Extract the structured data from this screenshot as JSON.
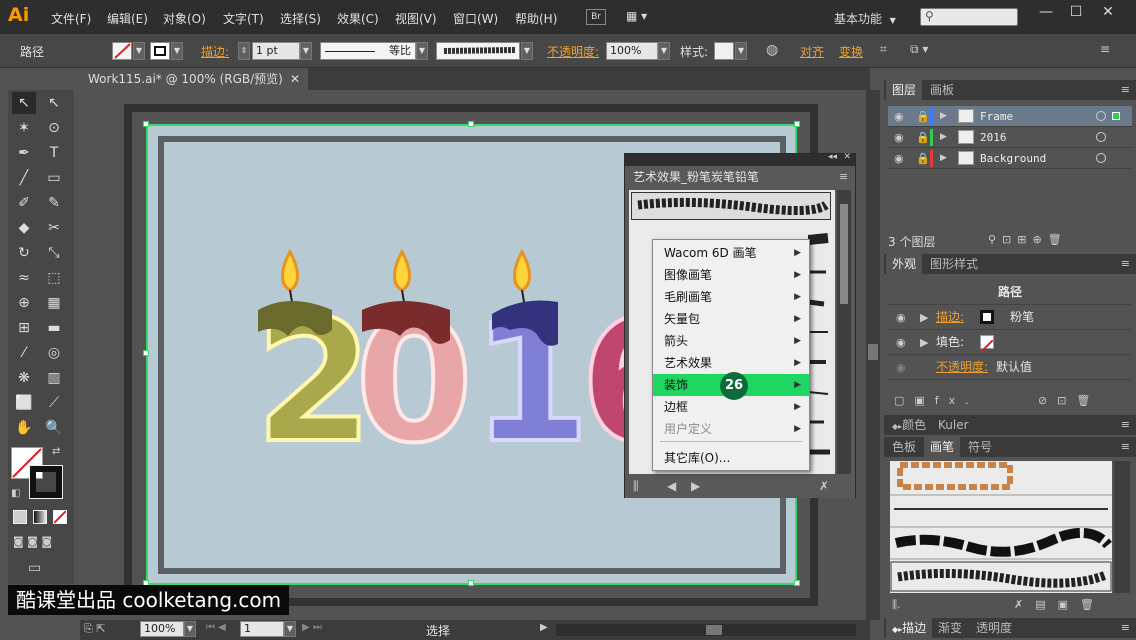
{
  "app": {
    "logo": "Ai"
  },
  "menu": [
    "文件(F)",
    "编辑(E)",
    "对象(O)",
    "文字(T)",
    "选择(S)",
    "效果(C)",
    "视图(V)",
    "窗口(W)",
    "帮助(H)"
  ],
  "toolbar_top": {
    "br": "Br",
    "workspace": "基本功能",
    "workspace_arrow": "▼",
    "min": "—",
    "max": "☐",
    "close": "✕"
  },
  "control": {
    "selection_type": "路径",
    "stroke_label": "描边:",
    "stroke_weight": "1 pt",
    "profile_label": "等比",
    "opacity_label": "不透明度:",
    "opacity_value": "100%",
    "style_label": "样式:",
    "align_label": "对齐",
    "transform_label": "变换"
  },
  "document": {
    "tab_title": "Work115.ai* @ 100% (RGB/预览)",
    "close": "✕"
  },
  "status": {
    "zoom": "100%",
    "page": "1",
    "mode": "选择"
  },
  "watermark": "酷课堂出品 coolketang.com",
  "brush_panel": {
    "title": "艺术效果_粉笔炭笔铅笔"
  },
  "flyout": {
    "items": [
      {
        "label": "Wacom 6D 画笔",
        "submenu": true,
        "state": "normal"
      },
      {
        "label": "图像画笔",
        "submenu": true,
        "state": "normal"
      },
      {
        "label": "毛刷画笔",
        "submenu": true,
        "state": "normal"
      },
      {
        "label": "矢量包",
        "submenu": true,
        "state": "normal"
      },
      {
        "label": "箭头",
        "submenu": true,
        "state": "normal"
      },
      {
        "label": "艺术效果",
        "submenu": true,
        "state": "normal"
      },
      {
        "label": "装饰",
        "submenu": true,
        "state": "active"
      },
      {
        "label": "边框",
        "submenu": true,
        "state": "normal"
      },
      {
        "label": "用户定义",
        "submenu": true,
        "state": "disabled"
      },
      {
        "label": "其它库(O)...",
        "submenu": false,
        "state": "normal"
      }
    ]
  },
  "step_badge": "26",
  "layers_panel": {
    "tabs": [
      "图层",
      "画板"
    ],
    "layers": [
      {
        "name": "Frame",
        "color": "#3a7bff"
      },
      {
        "name": "2016",
        "color": "#2fcf4f"
      },
      {
        "name": "Background",
        "color": "#e23c3c"
      }
    ],
    "count": "3 个图层"
  },
  "appearance_panel": {
    "tabs": [
      "外观",
      "图形样式"
    ],
    "title": "路径",
    "stroke_label": "描边:",
    "stroke_value": "粉笔",
    "fill_label": "填色:",
    "opacity_label": "不透明度:",
    "opacity_value": "默认值"
  },
  "color_panel": {
    "tabs": [
      "颜色",
      "Kuler"
    ]
  },
  "brushes_panel": {
    "tabs": [
      "色板",
      "画笔",
      "符号"
    ]
  },
  "stroke_panel": {
    "tabs": [
      "描边",
      "渐变",
      "透明度"
    ]
  },
  "candles": [
    {
      "digit": "2",
      "body": "#a9a84a",
      "drip": "#6a6a2d"
    },
    {
      "digit": "0",
      "body": "#e8a6a8",
      "drip": "#7a2b2b"
    },
    {
      "digit": "1",
      "body": "#7f7fd6",
      "drip": "#33337d"
    },
    {
      "digit": "6",
      "body": "#c1466f",
      "drip": "#7a1f3f"
    }
  ]
}
